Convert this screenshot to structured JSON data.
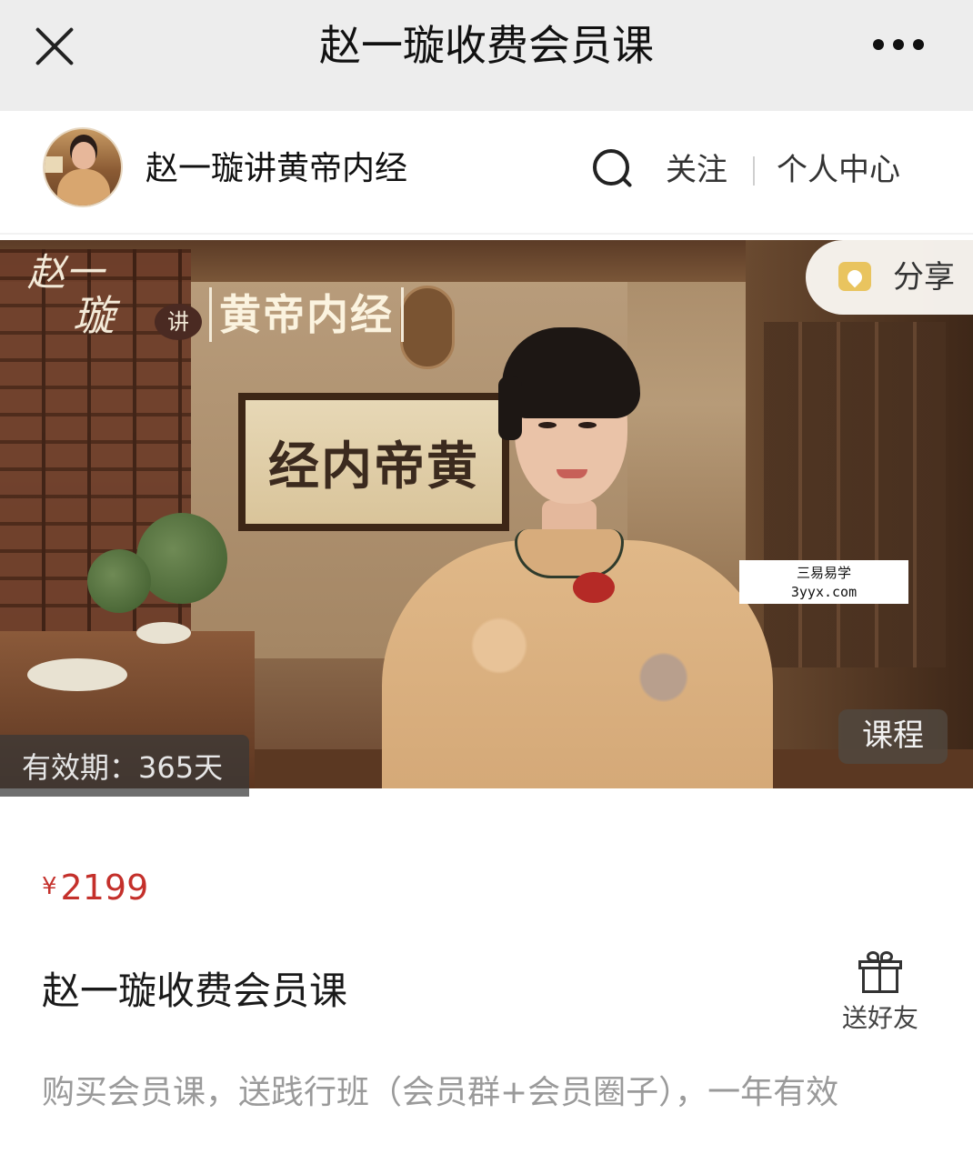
{
  "nav": {
    "title": "赵一璇收费会员课",
    "close_icon": "close-icon",
    "more_icon": "more-dots-icon"
  },
  "shop": {
    "name": "赵一璇讲黄帝内经",
    "search_icon": "search-icon",
    "follow_label": "关注",
    "center_label": "个人中心"
  },
  "banner": {
    "logo_zhao": "赵一",
    "logo_xuan": "璇",
    "logo_jiang": "讲",
    "logo_title": "黄帝内经",
    "calligraphy": "经内帝黄",
    "share_label": "分享",
    "share_icon": "share-icon",
    "validity": "有效期：365天",
    "type_badge": "课程",
    "watermark_line1": "三易易学",
    "watermark_line2": "3yyx.com"
  },
  "product": {
    "currency": "¥",
    "price": "2199",
    "title": "赵一璇收费会员课",
    "gift_label": "送好友",
    "gift_icon": "gift-icon",
    "description": "购买会员课，送践行班（会员群+会员圈子），一年有效"
  },
  "colors": {
    "nav_bg": "#ededed",
    "price": "#c4302b",
    "description": "#9a9a9a",
    "share_icon": "#e9c45f"
  }
}
